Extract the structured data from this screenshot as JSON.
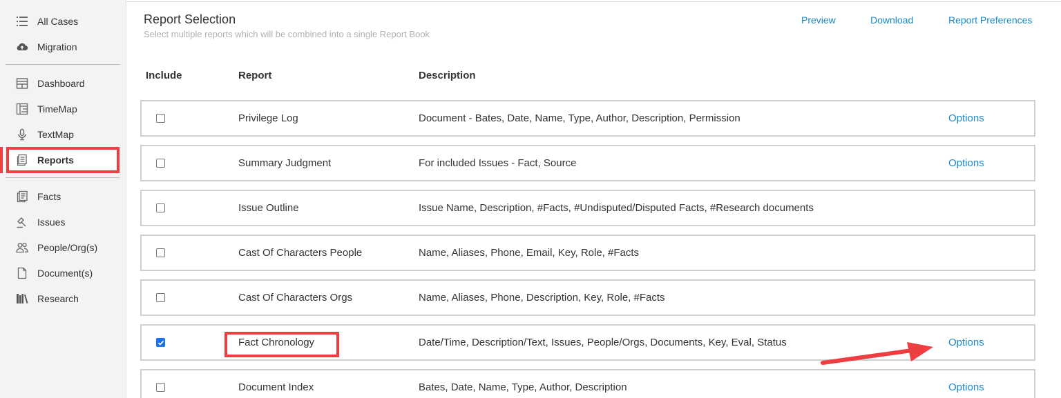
{
  "sidebar": {
    "items": [
      {
        "label": "All Cases",
        "icon": "list-icon"
      },
      {
        "label": "Migration",
        "icon": "cloud-upload-icon"
      },
      {
        "label": "Dashboard",
        "icon": "dashboard-icon"
      },
      {
        "label": "TimeMap",
        "icon": "timemap-icon"
      },
      {
        "label": "TextMap",
        "icon": "microphone-icon"
      },
      {
        "label": "Reports",
        "icon": "reports-icon",
        "active": true
      },
      {
        "label": "Facts",
        "icon": "facts-icon"
      },
      {
        "label": "Issues",
        "icon": "gavel-icon"
      },
      {
        "label": "People/Org(s)",
        "icon": "people-icon"
      },
      {
        "label": "Document(s)",
        "icon": "document-icon"
      },
      {
        "label": "Research",
        "icon": "library-icon"
      }
    ]
  },
  "header": {
    "title": "Report Selection",
    "subtitle": "Select multiple reports which will be combined into a single Report Book",
    "preview_label": "Preview",
    "download_label": "Download",
    "preferences_label": "Report Preferences"
  },
  "table": {
    "columns": [
      "Include",
      "Report",
      "Description"
    ],
    "rows": [
      {
        "name": "Privilege Log",
        "description": "Document - Bates, Date, Name, Type, Author, Description, Permission",
        "checked": false,
        "options": "Options"
      },
      {
        "name": "Summary Judgment",
        "description": "For included Issues - Fact, Source",
        "checked": false,
        "options": "Options"
      },
      {
        "name": "Issue Outline",
        "description": "Issue Name, Description, #Facts, #Undisputed/Disputed Facts, #Research documents",
        "checked": false,
        "options": ""
      },
      {
        "name": "Cast Of Characters People",
        "description": "Name, Aliases, Phone, Email, Key, Role, #Facts",
        "checked": false,
        "options": ""
      },
      {
        "name": "Cast Of Characters Orgs",
        "description": "Name, Aliases, Phone, Description, Key, Role, #Facts",
        "checked": false,
        "options": ""
      },
      {
        "name": "Fact Chronology",
        "description": "Date/Time, Description/Text, Issues, People/Orgs, Documents, Key, Eval, Status",
        "checked": true,
        "options": "Options"
      },
      {
        "name": "Document Index",
        "description": "Bates, Date, Name, Type, Author, Description",
        "checked": false,
        "options": "Options"
      }
    ]
  },
  "colors": {
    "accent": "#1a88c9",
    "annotation_red": "#ef3e42"
  }
}
